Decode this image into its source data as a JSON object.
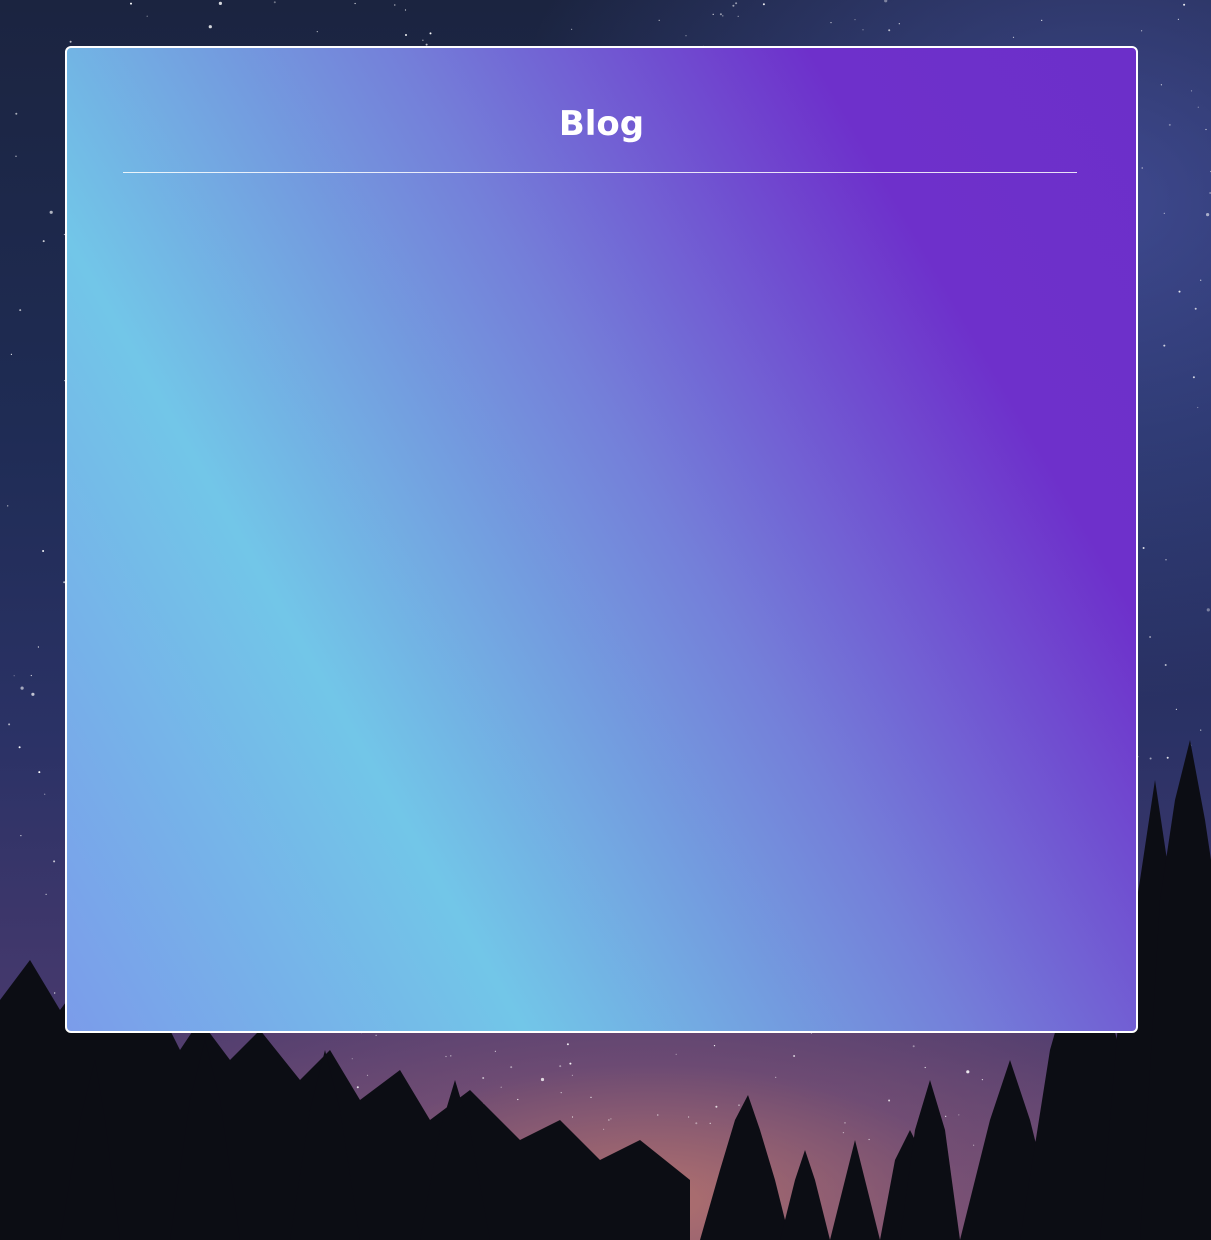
{
  "page": {
    "background": "night-sky-with-pine-trees",
    "accent_start": "#72c6e8",
    "accent_end": "#6c2fc9"
  },
  "blog": {
    "title": "Blog",
    "posts": []
  }
}
